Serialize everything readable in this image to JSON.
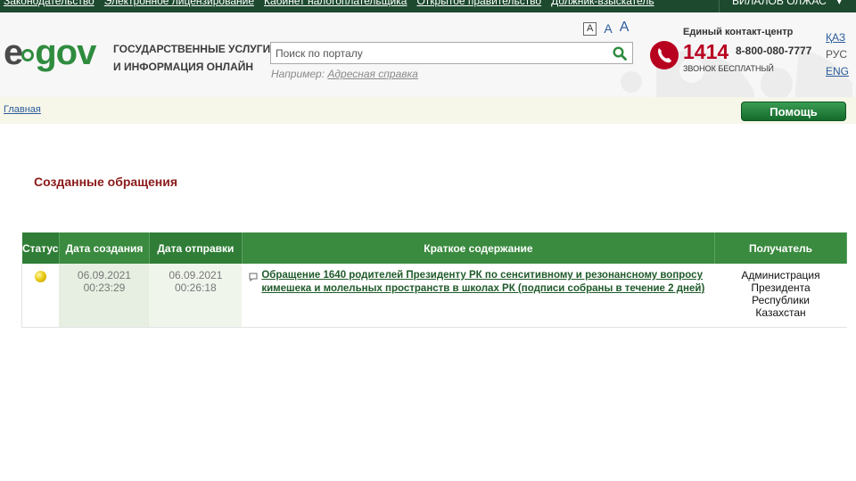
{
  "topnav": {
    "links": [
      "Законодательство",
      "Электронное лицензирование",
      "Кабинет налогоплательщика",
      "Открытое правительство",
      "Должник-взыскатель"
    ],
    "user": "БИЛАЛОВ ОЛЖАС"
  },
  "header": {
    "logo_e": "e",
    "logo_gov": "gov",
    "tagline_line1": "ГОСУДАРСТВЕННЫЕ УСЛУГИ",
    "tagline_line2": "И ИНФОРМАЦИЯ ОНЛАЙН",
    "search_placeholder": "Поиск по порталу",
    "example_label": "Например:",
    "example_link": "Адресная справка",
    "font_sizes": [
      "A",
      "A",
      "A"
    ],
    "contact_title": "Единый контакт-центр",
    "contact_number": "1414",
    "contact_phone": "8-800-080-7777",
    "contact_free": "ЗВОНОК БЕСПЛАТНЫЙ",
    "languages": [
      "ҚАЗ",
      "РУС",
      "ENG"
    ]
  },
  "breadcrumb": {
    "home": "Главная"
  },
  "help_button": "Помощь",
  "page_title": "Созданные обращения",
  "table": {
    "headers": [
      "Статус",
      "Дата создания",
      "Дата отправки",
      "Краткое содержание",
      "Получатель"
    ],
    "rows": [
      {
        "status_color": "#e4c400",
        "created_date": "06.09.2021",
        "created_time": "00:23:29",
        "sent_date": "06.09.2021",
        "sent_time": "00:26:18",
        "summary": "Обращение 1640 родителей Президенту РК по сенситивному и резонансному вопросу кимешека и молельных пространств в школах РК (подписи собраны в течение 2 дней)",
        "recipient_lines": [
          "Администрация",
          "Президента",
          "Республики",
          "Казахстан"
        ]
      }
    ]
  },
  "colors": {
    "topbar": "#1d4a2f",
    "header_green": "#3a8a3f",
    "title_red": "#8b1a1a",
    "contact_red": "#b8001f",
    "link_blue": "#2c5d9c"
  }
}
